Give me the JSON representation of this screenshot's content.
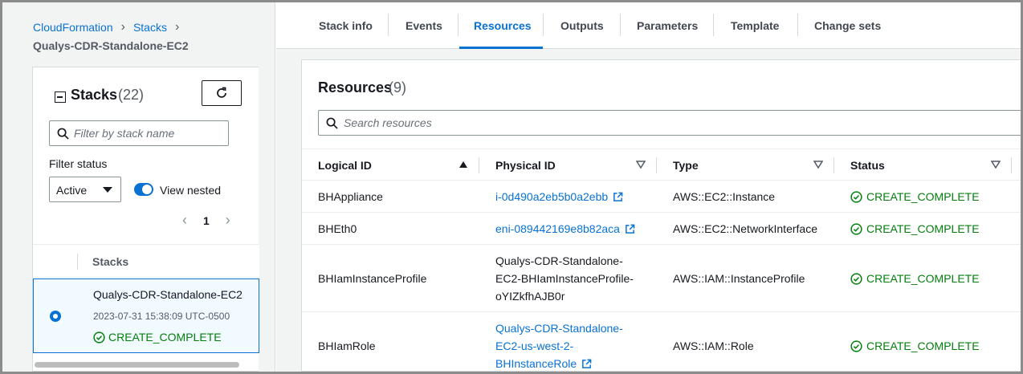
{
  "breadcrumb": {
    "items": [
      "CloudFormation",
      "Stacks"
    ],
    "current": "Qualys-CDR-Standalone-EC2"
  },
  "stacks_panel": {
    "title": "Stacks",
    "count": "(22)",
    "filter_placeholder": "Filter by stack name",
    "filter_status_label": "Filter status",
    "filter_status_value": "Active",
    "view_nested_label": "View nested",
    "view_nested_enabled": true,
    "page": "1",
    "column_header": "Stacks",
    "selected_stack": {
      "name": "Qualys-CDR-Standalone-EC2",
      "timestamp": "2023-07-31 15:38:09 UTC-0500",
      "status": "CREATE_COMPLETE"
    }
  },
  "tabs": [
    "Stack info",
    "Events",
    "Resources",
    "Outputs",
    "Parameters",
    "Template",
    "Change sets"
  ],
  "active_tab": "Resources",
  "resources": {
    "title": "Resources",
    "count": "(9)",
    "search_placeholder": "Search resources",
    "columns": [
      "Logical ID",
      "Physical ID",
      "Type",
      "Status"
    ],
    "rows": [
      {
        "logical_id": "BHAppliance",
        "physical_id": [
          "i-0d490a2eb5b0a2ebb"
        ],
        "physical_link": true,
        "type": "AWS::EC2::Instance",
        "status": "CREATE_COMPLETE"
      },
      {
        "logical_id": "BHEth0",
        "physical_id": [
          "eni-089442169e8b82aca"
        ],
        "physical_link": true,
        "type": "AWS::EC2::NetworkInterface",
        "status": "CREATE_COMPLETE"
      },
      {
        "logical_id": "BHIamInstanceProfile",
        "physical_id": [
          "Qualys-CDR-Standalone-",
          "EC2-BHIamInstanceProfile-",
          "oYIZkfhAJB0r"
        ],
        "physical_link": false,
        "type": "AWS::IAM::InstanceProfile",
        "status": "CREATE_COMPLETE"
      },
      {
        "logical_id": "BHIamRole",
        "physical_id": [
          "Qualys-CDR-Standalone-",
          "EC2-us-west-2-",
          "BHInstanceRole"
        ],
        "physical_link": true,
        "type": "AWS::IAM::Role",
        "status": "CREATE_COMPLETE"
      }
    ]
  },
  "colors": {
    "link": "#0972d3",
    "success": "#037f0c",
    "background": "#f2f3f3"
  }
}
